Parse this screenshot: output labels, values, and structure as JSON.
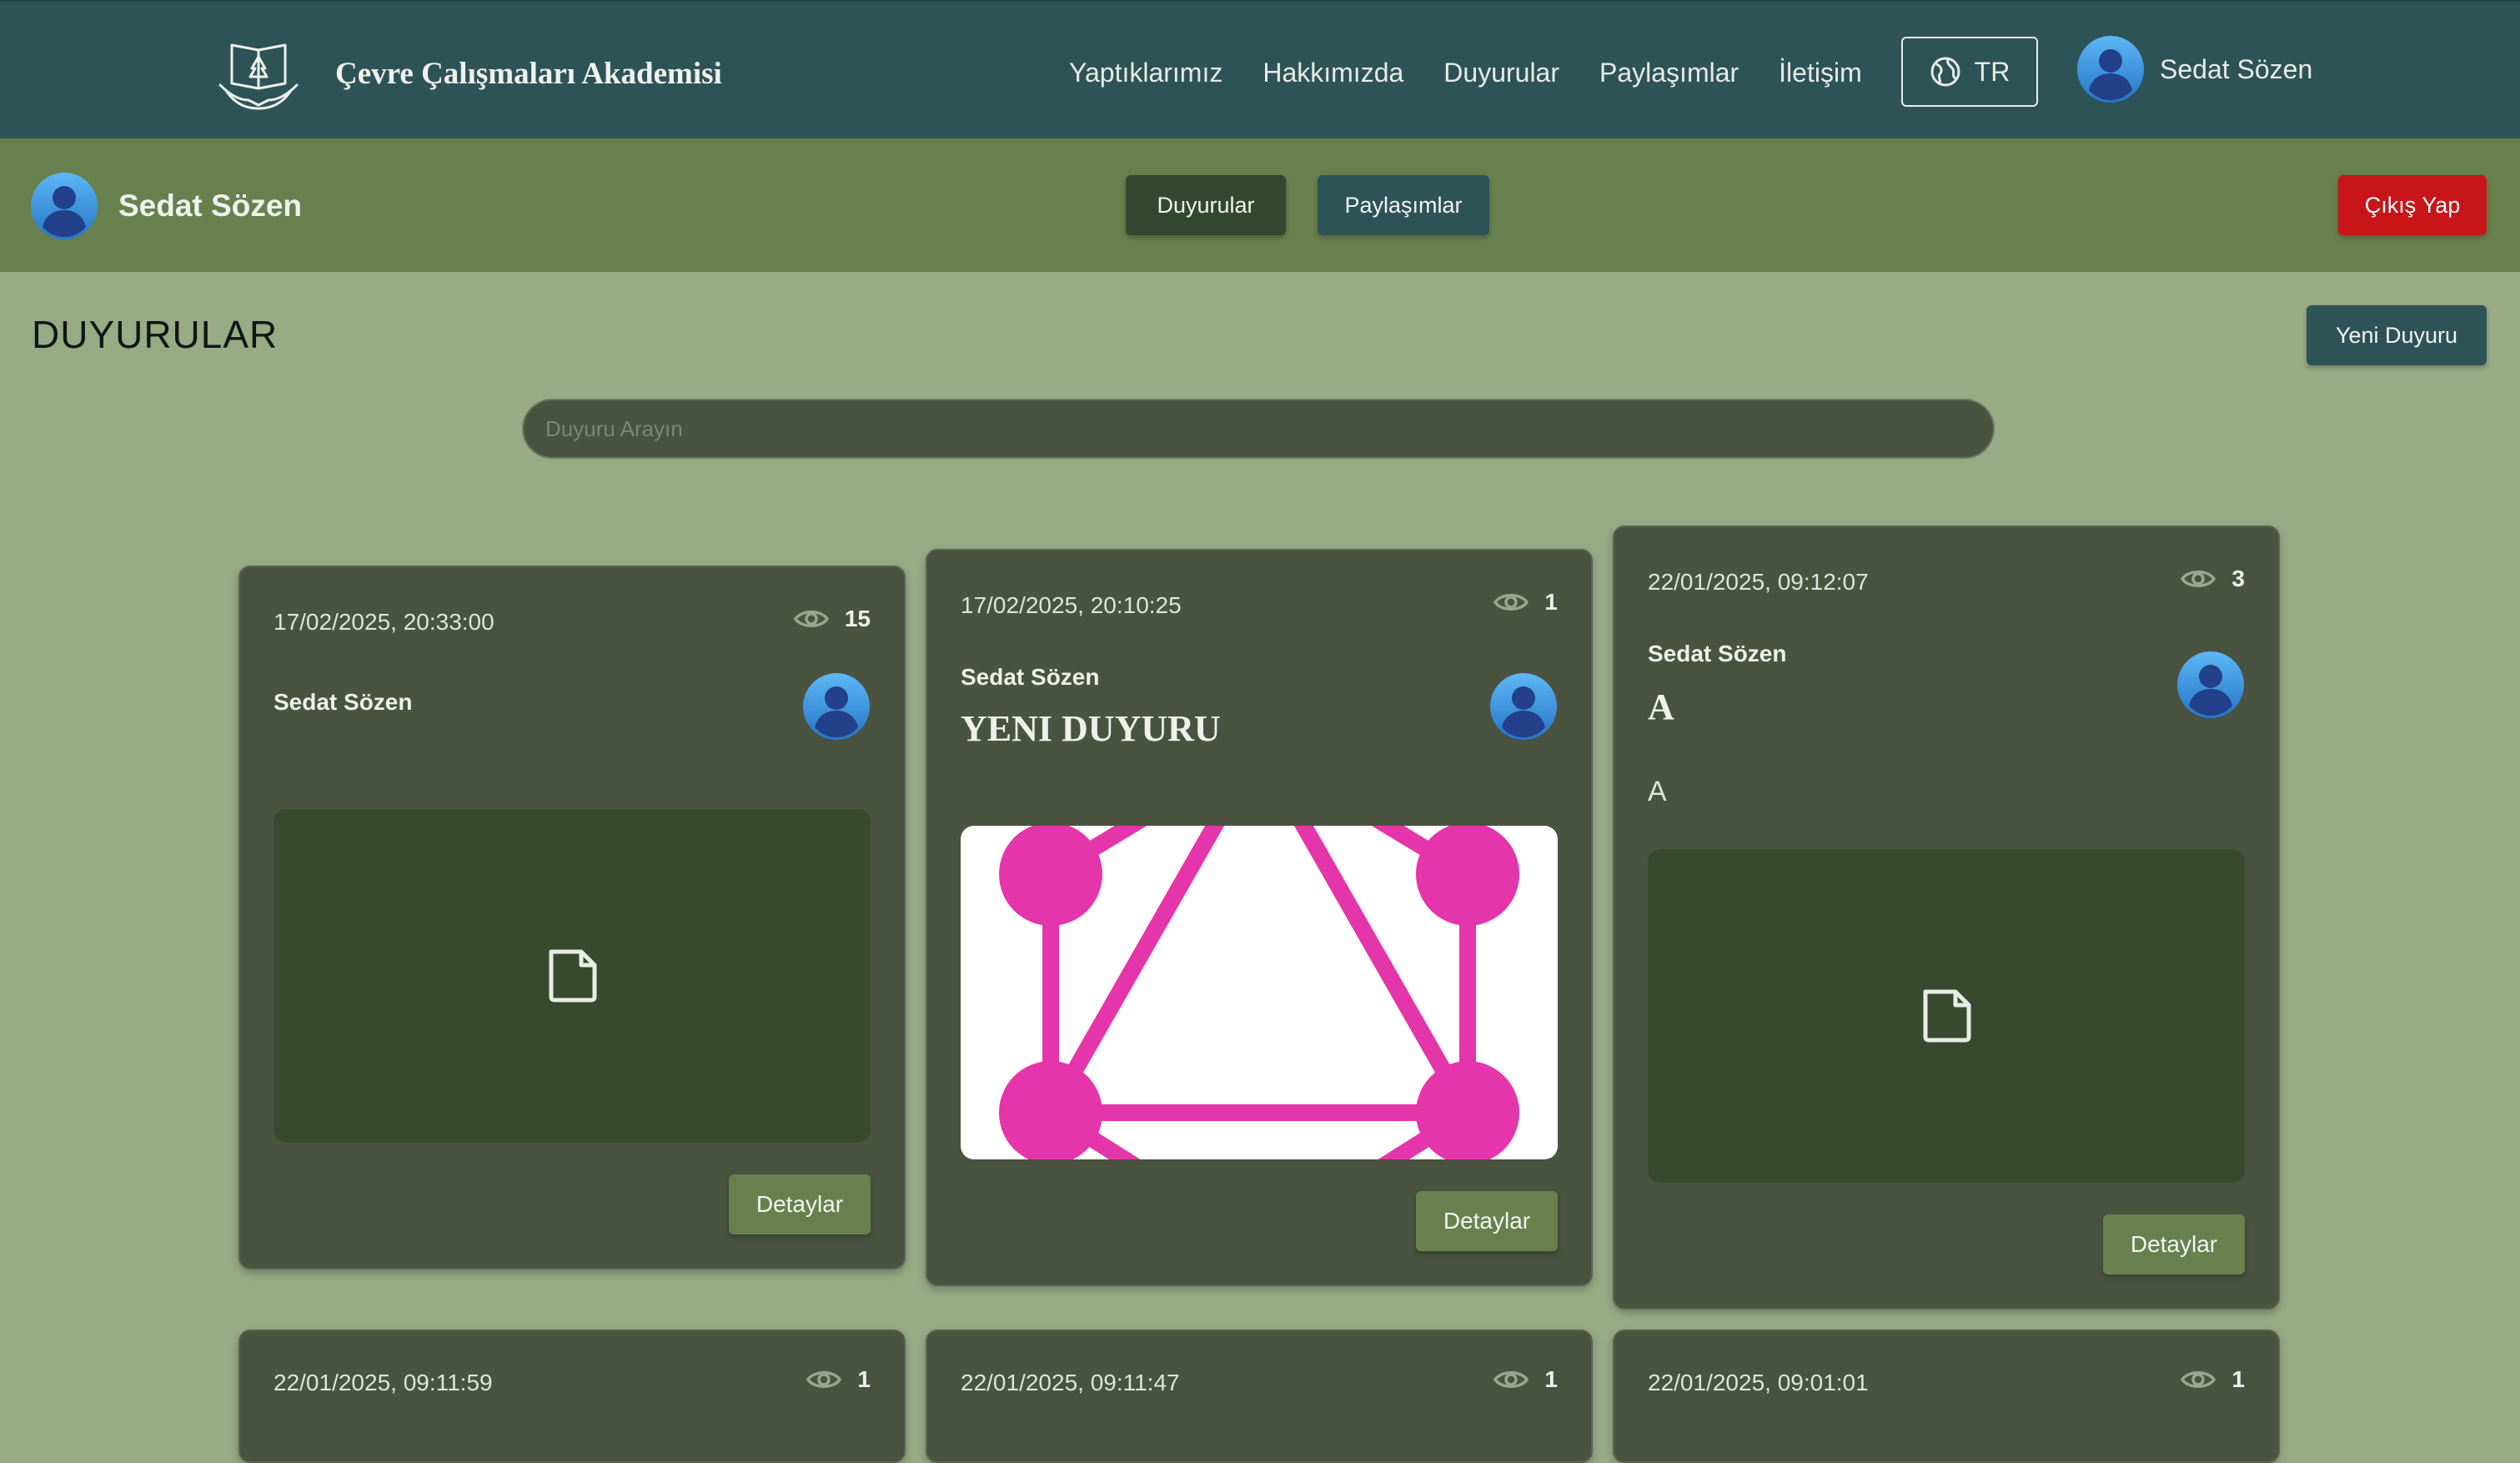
{
  "header": {
    "site_title": "Çevre Çalışmaları Akademisi",
    "nav": [
      "Yaptıklarımız",
      "Hakkımızda",
      "Duyurular",
      "Paylaşımlar",
      "İletişim"
    ],
    "language": "TR",
    "user_name": "Sedat Sözen"
  },
  "subheader": {
    "user_name": "Sedat Sözen",
    "announcements_label": "Duyurular",
    "shares_label": "Paylaşımlar",
    "logout_label": "Çıkış Yap"
  },
  "main": {
    "title": "DUYURULAR",
    "new_button": "Yeni Duyuru",
    "search_placeholder": "Duyuru Arayın",
    "cards": [
      {
        "date": "17/02/2025, 20:33:00",
        "views": "15",
        "author": "Sedat Sözen",
        "title": "",
        "body": "",
        "media": "file-icon",
        "details": "Detaylar"
      },
      {
        "date": "17/02/2025, 20:10:25",
        "views": "1",
        "author": "Sedat Sözen",
        "title": "YENI DUYURU",
        "body": "",
        "media": "graphql-logo",
        "details": "Detaylar"
      },
      {
        "date": "22/01/2025, 09:12:07",
        "views": "3",
        "author": "Sedat Sözen",
        "title": "A",
        "body": "A",
        "media": "file-icon",
        "details": "Detaylar"
      },
      {
        "date": "22/01/2025, 09:11:59",
        "views": "1"
      },
      {
        "date": "22/01/2025, 09:11:47",
        "views": "1"
      },
      {
        "date": "22/01/2025, 09:01:01",
        "views": "1"
      }
    ]
  },
  "colors": {
    "topbar": "#2e5357",
    "subbar": "#68804e",
    "page_bg": "#98ab85",
    "card_bg": "#4a5240",
    "media_bg": "#374a2e",
    "logout": "#c8151a",
    "accent_pink": "#e535ab"
  }
}
